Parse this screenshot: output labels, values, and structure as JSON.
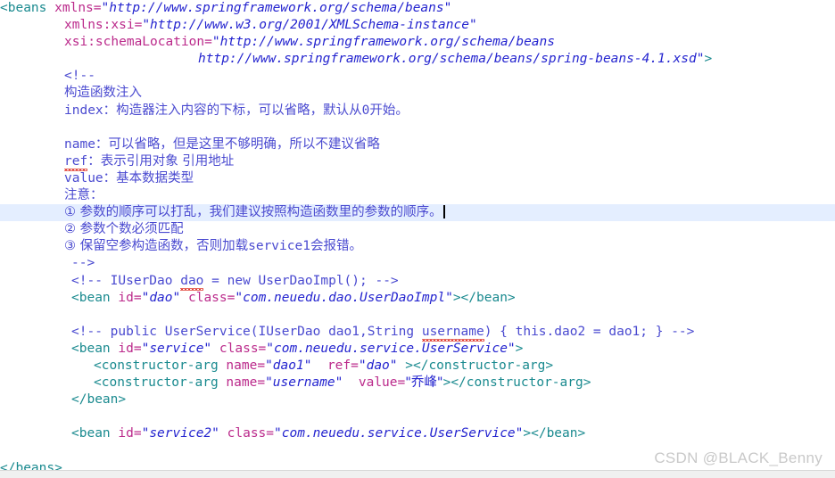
{
  "editor": {
    "file_type": "xml",
    "theme": "light",
    "colors": {
      "background": "#ffffff",
      "tag": "#1a8a8f",
      "attribute": "#bb2a8b",
      "attribute_value": "#2424cf",
      "comment": "#4a4ad0",
      "plain_text": "#000000",
      "current_line_highlight": "#e4eeff",
      "caret": "#000000",
      "spellcheck_squiggle": "#e03a2f",
      "watermark": "#c9c9c9",
      "bottom_bar": "#f0f0f0"
    },
    "current_line_number": 12,
    "caret_visible": true
  },
  "code": {
    "lines": [
      {
        "n": 1,
        "indent": 0,
        "tokens": [
          {
            "t": "tag",
            "s": "<beans"
          },
          {
            "t": "plain",
            "s": " "
          },
          {
            "t": "attr",
            "s": "xmlns="
          },
          {
            "t": "val",
            "s": "\"http://www.springframework.org/schema/beans\""
          }
        ]
      },
      {
        "n": 2,
        "indent": 72,
        "tokens": [
          {
            "t": "attr",
            "s": "xmlns:xsi="
          },
          {
            "t": "val",
            "s": "\"http://www.w3.org/2001/XMLSchema-instance\""
          }
        ]
      },
      {
        "n": 3,
        "indent": 72,
        "tokens": [
          {
            "t": "attr",
            "s": "xsi:schemaLocation="
          },
          {
            "t": "val",
            "s": "\"http://www.springframework.org/schema/beans"
          }
        ]
      },
      {
        "n": 4,
        "indent": 222,
        "tokens": [
          {
            "t": "val",
            "s": "http://www.springframework.org/schema/beans/spring-beans-4.1.xsd\""
          },
          {
            "t": "tag",
            "s": ">"
          }
        ]
      },
      {
        "n": 5,
        "indent": 72,
        "tokens": [
          {
            "t": "comment",
            "s": "<!--"
          }
        ]
      },
      {
        "n": 6,
        "indent": 72,
        "tokens": [
          {
            "t": "comment-cjk",
            "s": "构造函数注入"
          }
        ]
      },
      {
        "n": 7,
        "indent": 72,
        "tokens": [
          {
            "t": "comment",
            "s": "index"
          },
          {
            "t": "comment-cjk",
            "s": "：构造器注入内容的下标，可以省略，默认从"
          },
          {
            "t": "comment",
            "s": "0"
          },
          {
            "t": "comment-cjk",
            "s": "开始。"
          }
        ]
      },
      {
        "n": 8,
        "indent": 72,
        "tokens": []
      },
      {
        "n": 9,
        "indent": 72,
        "tokens": [
          {
            "t": "comment",
            "s": "name"
          },
          {
            "t": "comment-cjk",
            "s": "：可以省略，但是这里不够明确，所以不建议省略"
          }
        ]
      },
      {
        "n": 10,
        "indent": 72,
        "tokens": [
          {
            "t": "comment-squiggle",
            "s": "ref"
          },
          {
            "t": "comment-cjk",
            "s": "：表示引用对象 引用地址"
          }
        ]
      },
      {
        "n": 11,
        "indent": 72,
        "tokens": [
          {
            "t": "comment",
            "s": "value"
          },
          {
            "t": "comment-cjk",
            "s": "：基本数据类型"
          }
        ]
      },
      {
        "n": 12,
        "indent": 72,
        "tokens": [
          {
            "t": "comment-cjk",
            "s": "注意："
          }
        ]
      },
      {
        "n": 13,
        "indent": 72,
        "highlight": true,
        "caret": true,
        "tokens": [
          {
            "t": "comment-cjk",
            "s": "① 参数的顺序可以打乱，我们建议按照构造函数里的参数的顺序。"
          }
        ]
      },
      {
        "n": 14,
        "indent": 72,
        "tokens": [
          {
            "t": "comment-cjk",
            "s": "② 参数个数必须匹配"
          }
        ]
      },
      {
        "n": 15,
        "indent": 72,
        "tokens": [
          {
            "t": "comment-cjk",
            "s": "③ 保留空参构造函数，否则加载"
          },
          {
            "t": "comment",
            "s": "service1"
          },
          {
            "t": "comment-cjk",
            "s": "会报错。"
          }
        ]
      },
      {
        "n": 16,
        "indent": 80,
        "tokens": [
          {
            "t": "comment",
            "s": "-->"
          }
        ]
      },
      {
        "n": 17,
        "indent": 80,
        "tokens": [
          {
            "t": "comment",
            "s": "<!-- IUserDao "
          },
          {
            "t": "comment-squiggle",
            "s": "dao"
          },
          {
            "t": "comment",
            "s": " = new UserDaoImpl(); -->"
          }
        ]
      },
      {
        "n": 18,
        "indent": 80,
        "tokens": [
          {
            "t": "tag",
            "s": "<bean"
          },
          {
            "t": "plain",
            "s": " "
          },
          {
            "t": "attr",
            "s": "id="
          },
          {
            "t": "val",
            "s": "\"dao\""
          },
          {
            "t": "plain",
            "s": " "
          },
          {
            "t": "attr",
            "s": "class="
          },
          {
            "t": "val",
            "s": "\"com.neuedu.dao.UserDaoImpl\""
          },
          {
            "t": "tag",
            "s": "></bean>"
          }
        ]
      },
      {
        "n": 19,
        "indent": 80,
        "tokens": []
      },
      {
        "n": 20,
        "indent": 80,
        "tokens": [
          {
            "t": "comment",
            "s": "<!-- public UserService(IUserDao dao1,String "
          },
          {
            "t": "comment-squiggle",
            "s": "username"
          },
          {
            "t": "comment",
            "s": ") { this.dao2 = dao1; } -->"
          }
        ]
      },
      {
        "n": 21,
        "indent": 80,
        "tokens": [
          {
            "t": "tag",
            "s": "<bean"
          },
          {
            "t": "plain",
            "s": " "
          },
          {
            "t": "attr",
            "s": "id="
          },
          {
            "t": "val",
            "s": "\"service\""
          },
          {
            "t": "plain",
            "s": " "
          },
          {
            "t": "attr",
            "s": "class="
          },
          {
            "t": "val",
            "s": "\"com.neuedu.service.UserService\""
          },
          {
            "t": "tag",
            "s": ">"
          }
        ]
      },
      {
        "n": 22,
        "indent": 105,
        "tokens": [
          {
            "t": "tag",
            "s": "<constructor-arg"
          },
          {
            "t": "plain",
            "s": " "
          },
          {
            "t": "attr",
            "s": "name="
          },
          {
            "t": "val",
            "s": "\"dao1\""
          },
          {
            "t": "plain",
            "s": "  "
          },
          {
            "t": "attr",
            "s": "ref="
          },
          {
            "t": "val",
            "s": "\"dao\""
          },
          {
            "t": "plain",
            "s": " "
          },
          {
            "t": "tag",
            "s": "></constructor-arg>"
          }
        ]
      },
      {
        "n": 23,
        "indent": 105,
        "tokens": [
          {
            "t": "tag",
            "s": "<constructor-arg"
          },
          {
            "t": "plain",
            "s": " "
          },
          {
            "t": "attr",
            "s": "name="
          },
          {
            "t": "val",
            "s": "\"username\""
          },
          {
            "t": "plain",
            "s": "  "
          },
          {
            "t": "attr",
            "s": "value="
          },
          {
            "t": "val-cjk",
            "s": "\"乔峰\""
          },
          {
            "t": "tag",
            "s": "></constructor-arg>"
          }
        ]
      },
      {
        "n": 24,
        "indent": 80,
        "tokens": [
          {
            "t": "tag",
            "s": "</bean>"
          }
        ]
      },
      {
        "n": 25,
        "indent": 80,
        "tokens": []
      },
      {
        "n": 26,
        "indent": 80,
        "tokens": [
          {
            "t": "tag",
            "s": "<bean"
          },
          {
            "t": "plain",
            "s": " "
          },
          {
            "t": "attr",
            "s": "id="
          },
          {
            "t": "val",
            "s": "\"service2\""
          },
          {
            "t": "plain",
            "s": " "
          },
          {
            "t": "attr",
            "s": "class="
          },
          {
            "t": "val",
            "s": "\"com.neuedu.service.UserService\""
          },
          {
            "t": "tag",
            "s": "></bean>"
          }
        ]
      },
      {
        "n": 27,
        "indent": 0,
        "tokens": []
      },
      {
        "n": 28,
        "indent": 0,
        "tokens": [
          {
            "t": "tag",
            "s": "</beans>"
          }
        ]
      }
    ]
  },
  "watermark": {
    "text": "CSDN @BLACK_Benny"
  }
}
